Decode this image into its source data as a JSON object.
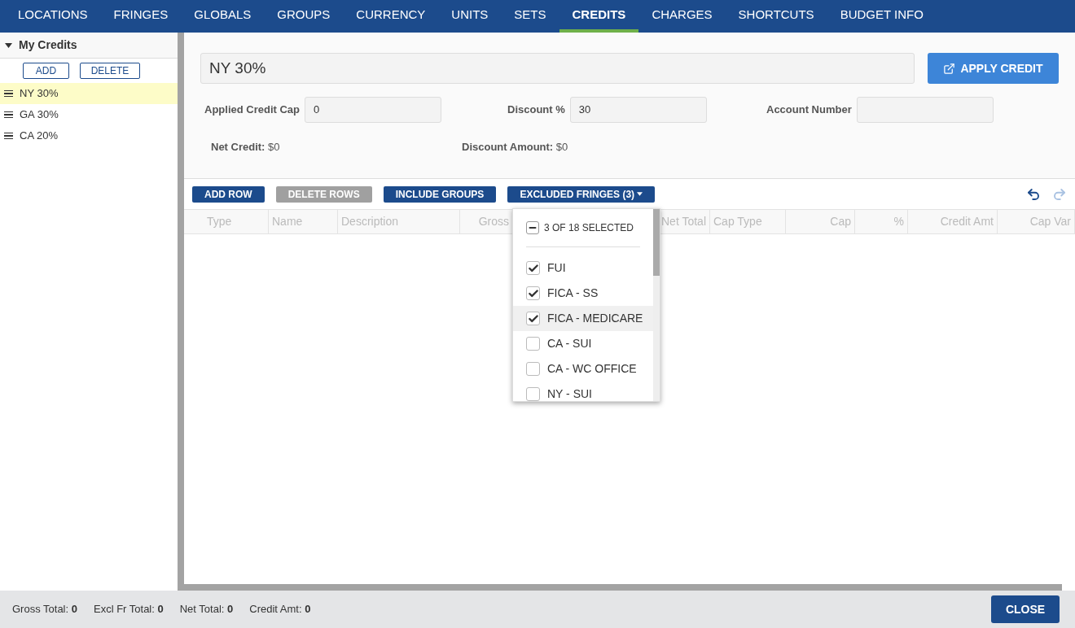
{
  "nav_tabs": [
    {
      "label": "LOCATIONS",
      "selected": false
    },
    {
      "label": "FRINGES",
      "selected": false
    },
    {
      "label": "GLOBALS",
      "selected": false
    },
    {
      "label": "GROUPS",
      "selected": false
    },
    {
      "label": "CURRENCY",
      "selected": false
    },
    {
      "label": "UNITS",
      "selected": false
    },
    {
      "label": "SETS",
      "selected": false
    },
    {
      "label": "CREDITS",
      "selected": true
    },
    {
      "label": "CHARGES",
      "selected": false
    },
    {
      "label": "SHORTCUTS",
      "selected": false
    },
    {
      "label": "BUDGET INFO",
      "selected": false
    }
  ],
  "sidebar": {
    "title": "My Credits",
    "expanded": true,
    "buttons": [
      "ADD",
      "DELETE"
    ],
    "items": [
      {
        "label": "NY 30%",
        "selected": true
      },
      {
        "label": "GA 30%",
        "selected": false
      },
      {
        "label": "CA 20%",
        "selected": false
      }
    ]
  },
  "credit": {
    "name": "NY 30%",
    "apply_button": "APPLY CREDIT",
    "fields": [
      {
        "label": "Applied Credit Cap",
        "value": "0"
      },
      {
        "label": "Discount %",
        "value": "30"
      },
      {
        "label": "Account Number"
      }
    ],
    "summary": [
      {
        "label": "Net Credit:",
        "value": "$0"
      },
      {
        "label": "Discount Amount:",
        "value": "$0"
      }
    ]
  },
  "toolbar": [
    {
      "label": "ADD ROW",
      "disabled": false,
      "dropdown": false
    },
    {
      "label": "DELETE ROWS",
      "disabled": true,
      "dropdown": false
    },
    {
      "label": "INCLUDE GROUPS",
      "disabled": false,
      "dropdown": false
    },
    {
      "label": "EXCLUDED FRINGES (3)",
      "disabled": false,
      "dropdown": true
    }
  ],
  "table": {
    "columns": [
      "Type",
      "Name",
      "Description",
      "Gross",
      "Net Total",
      "Cap Type",
      "Cap",
      "%",
      "Credit Amt",
      "Cap Var"
    ]
  },
  "fringe_menu": {
    "select_all_partial": true,
    "summary": "3 OF 18 SELECTED",
    "items": [
      {
        "label": "FUI",
        "checked": true,
        "selected": false
      },
      {
        "label": "FICA - SS",
        "checked": true,
        "selected": false
      },
      {
        "label": "FICA - MEDICARE",
        "checked": true,
        "selected": true
      },
      {
        "label": "CA - SUI",
        "checked": false,
        "selected": false
      },
      {
        "label": "CA - WC OFFICE",
        "checked": false,
        "selected": false
      },
      {
        "label": "NY - SUI",
        "checked": false,
        "selected": false
      }
    ]
  },
  "status_bar": [
    "Gross Total: **0**",
    "Excl Fr Total: **0**",
    "Net Total: **0**",
    "Credit Amt: **0**"
  ],
  "close_button": "CLOSE"
}
